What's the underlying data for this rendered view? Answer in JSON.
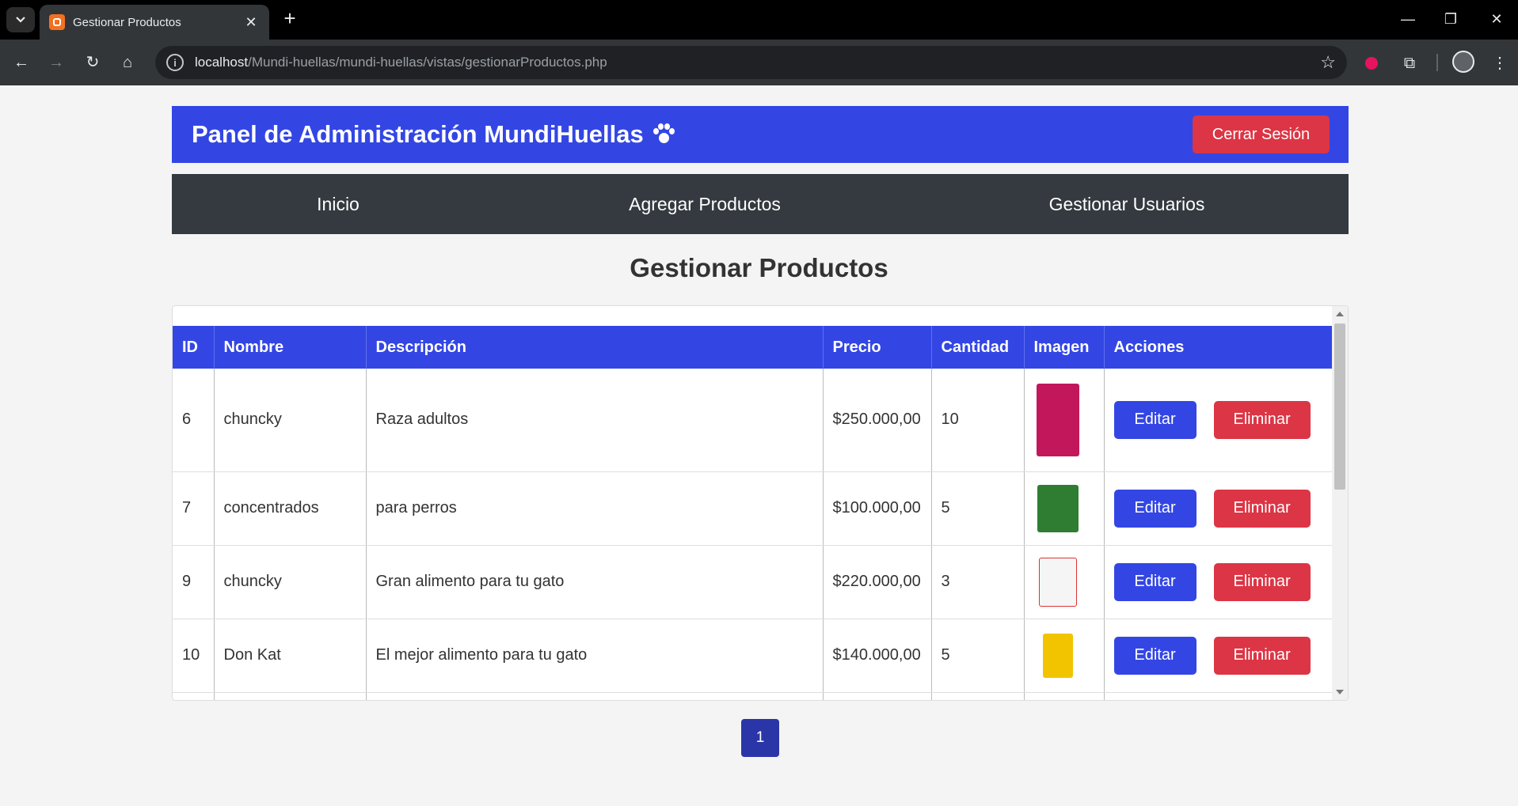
{
  "browser": {
    "tab_title": "Gestionar Productos",
    "url_host": "localhost",
    "url_path": "/Mundi-huellas/mundi-huellas/vistas/gestionarProductos.php"
  },
  "header": {
    "title": "Panel de Administración MundiHuellas",
    "logout_label": "Cerrar Sesión"
  },
  "nav": {
    "items": [
      "Inicio",
      "Agregar Productos",
      "Gestionar Usuarios"
    ]
  },
  "main": {
    "title": "Gestionar Productos",
    "table": {
      "headers": [
        "ID",
        "Nombre",
        "Descripción",
        "Precio",
        "Cantidad",
        "Imagen",
        "Acciones"
      ],
      "rows": [
        {
          "id": "6",
          "nombre": "chuncky",
          "descripcion": "Raza adultos",
          "precio": "$250.000,00",
          "cantidad": "10",
          "image_color": "#c2185b"
        },
        {
          "id": "7",
          "nombre": "concentrados",
          "descripcion": "para perros",
          "precio": "$100.000,00",
          "cantidad": "5",
          "image_color": "#2e7d32"
        },
        {
          "id": "9",
          "nombre": "chuncky",
          "descripcion": "Gran alimento para tu gato",
          "precio": "$220.000,00",
          "cantidad": "3",
          "image_color": "#f5f5f5"
        },
        {
          "id": "10",
          "nombre": "Don Kat",
          "descripcion": "El mejor alimento para tu gato",
          "precio": "$140.000,00",
          "cantidad": "5",
          "image_color": "#f2c400"
        }
      ],
      "edit_label": "Editar",
      "delete_label": "Eliminar"
    },
    "pagination": {
      "current": "1"
    }
  },
  "colors": {
    "primary": "#3346e4",
    "danger": "#dc3545",
    "nav_bg": "#343a40",
    "page_bg": "#f4f4f4"
  }
}
